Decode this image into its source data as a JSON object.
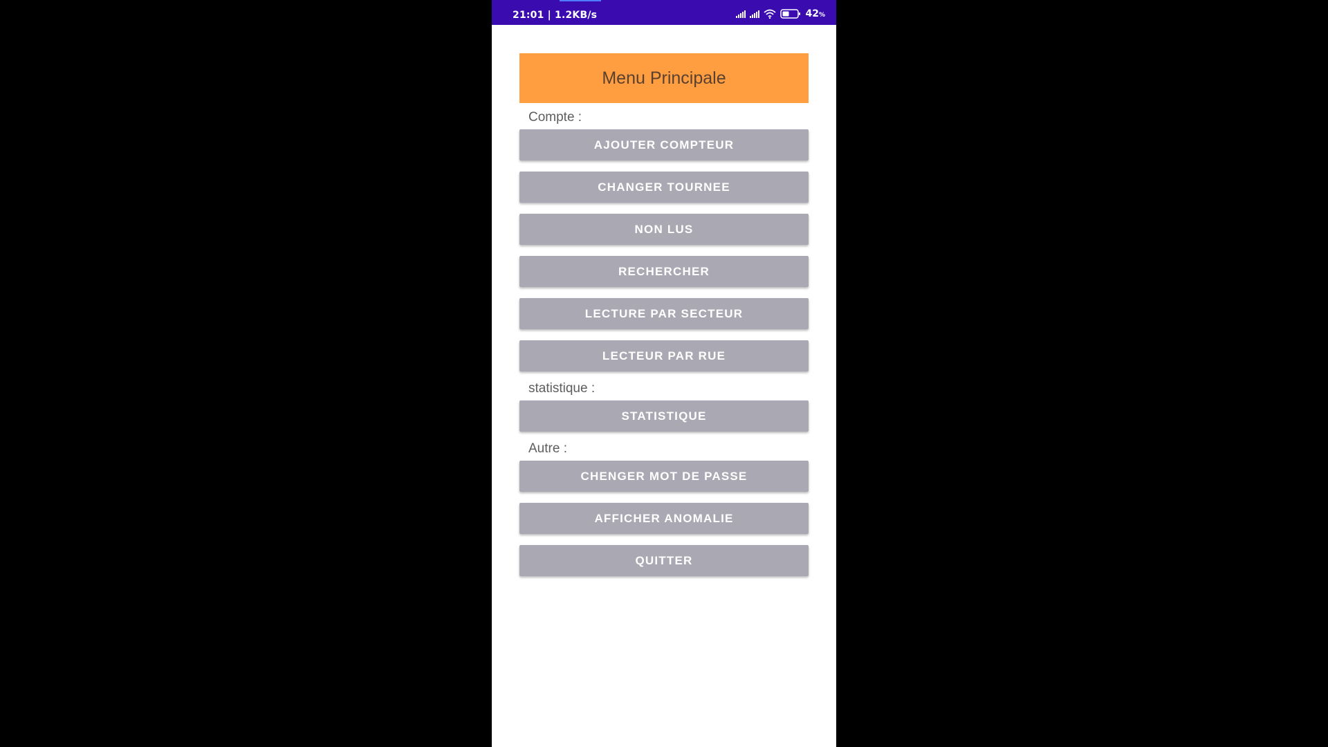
{
  "status_bar": {
    "time_speed": "21:01 | 1.2KB/s",
    "battery_percent": "42",
    "battery_unit": "%",
    "icons": [
      "signal-icon",
      "signal-icon",
      "wifi-icon",
      "battery-icon"
    ],
    "color": "#3a0cb0"
  },
  "header": {
    "title": "Menu Principale",
    "color": "#fe9e40"
  },
  "sections": {
    "compte": {
      "label": "Compte :",
      "buttons": [
        "AJOUTER COMPTEUR",
        "CHANGER TOURNEE",
        "NON LUS",
        "RECHERCHER",
        "LECTURE PAR SECTEUR",
        "LECTEUR PAR RUE"
      ]
    },
    "statistique": {
      "label": "statistique :",
      "buttons": [
        "STATISTIQUE"
      ]
    },
    "autre": {
      "label": "Autre :",
      "buttons": [
        "CHENGER MOT DE PASSE",
        "AFFICHER ANOMALIE",
        "QUITTER"
      ]
    }
  },
  "button_color": "#aaa8b2"
}
